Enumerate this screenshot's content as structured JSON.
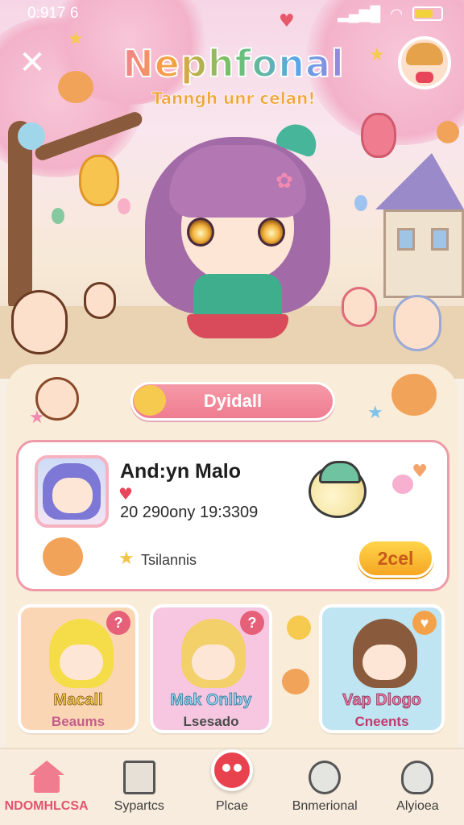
{
  "status_bar": {
    "time": "0:917 6"
  },
  "header": {
    "close_glyph": "✕",
    "title": "Nephfonal",
    "subtitle": "Tanngh unr celan!"
  },
  "panel": {
    "pill_label": "Dyidall"
  },
  "profile": {
    "name": "And:yn Malo",
    "meta": "20  290ony 19:3309",
    "tag": "Tsilannis",
    "action_label": "2cel"
  },
  "cards": [
    {
      "title": "Macall",
      "subtitle": "Beaums",
      "badge": "?",
      "bg": "#fbd6b4"
    },
    {
      "title": "Mak Onlby",
      "subtitle": "Lsesado",
      "badge": "?",
      "bg": "#f7c7e2"
    },
    {
      "title": "Vap Dlogo",
      "subtitle": "Cneents",
      "badge": "♥",
      "bg": "#bfe4f2"
    }
  ],
  "nav": {
    "items": [
      {
        "label": "NDOMHLCSA",
        "icon": "home-icon",
        "active": true
      },
      {
        "label": "Sypartcs",
        "icon": "box-icon",
        "active": false
      },
      {
        "label": "Plcae",
        "icon": "chat-bubble-icon",
        "active": false
      },
      {
        "label": "Bnmerional",
        "icon": "animal-icon",
        "active": false
      },
      {
        "label": "Alyioea",
        "icon": "seal-icon",
        "active": false
      }
    ]
  },
  "colors": {
    "accent_pink": "#ef7c90",
    "accent_yellow": "#f5a623",
    "panel_bg": "#f9ecd9"
  }
}
